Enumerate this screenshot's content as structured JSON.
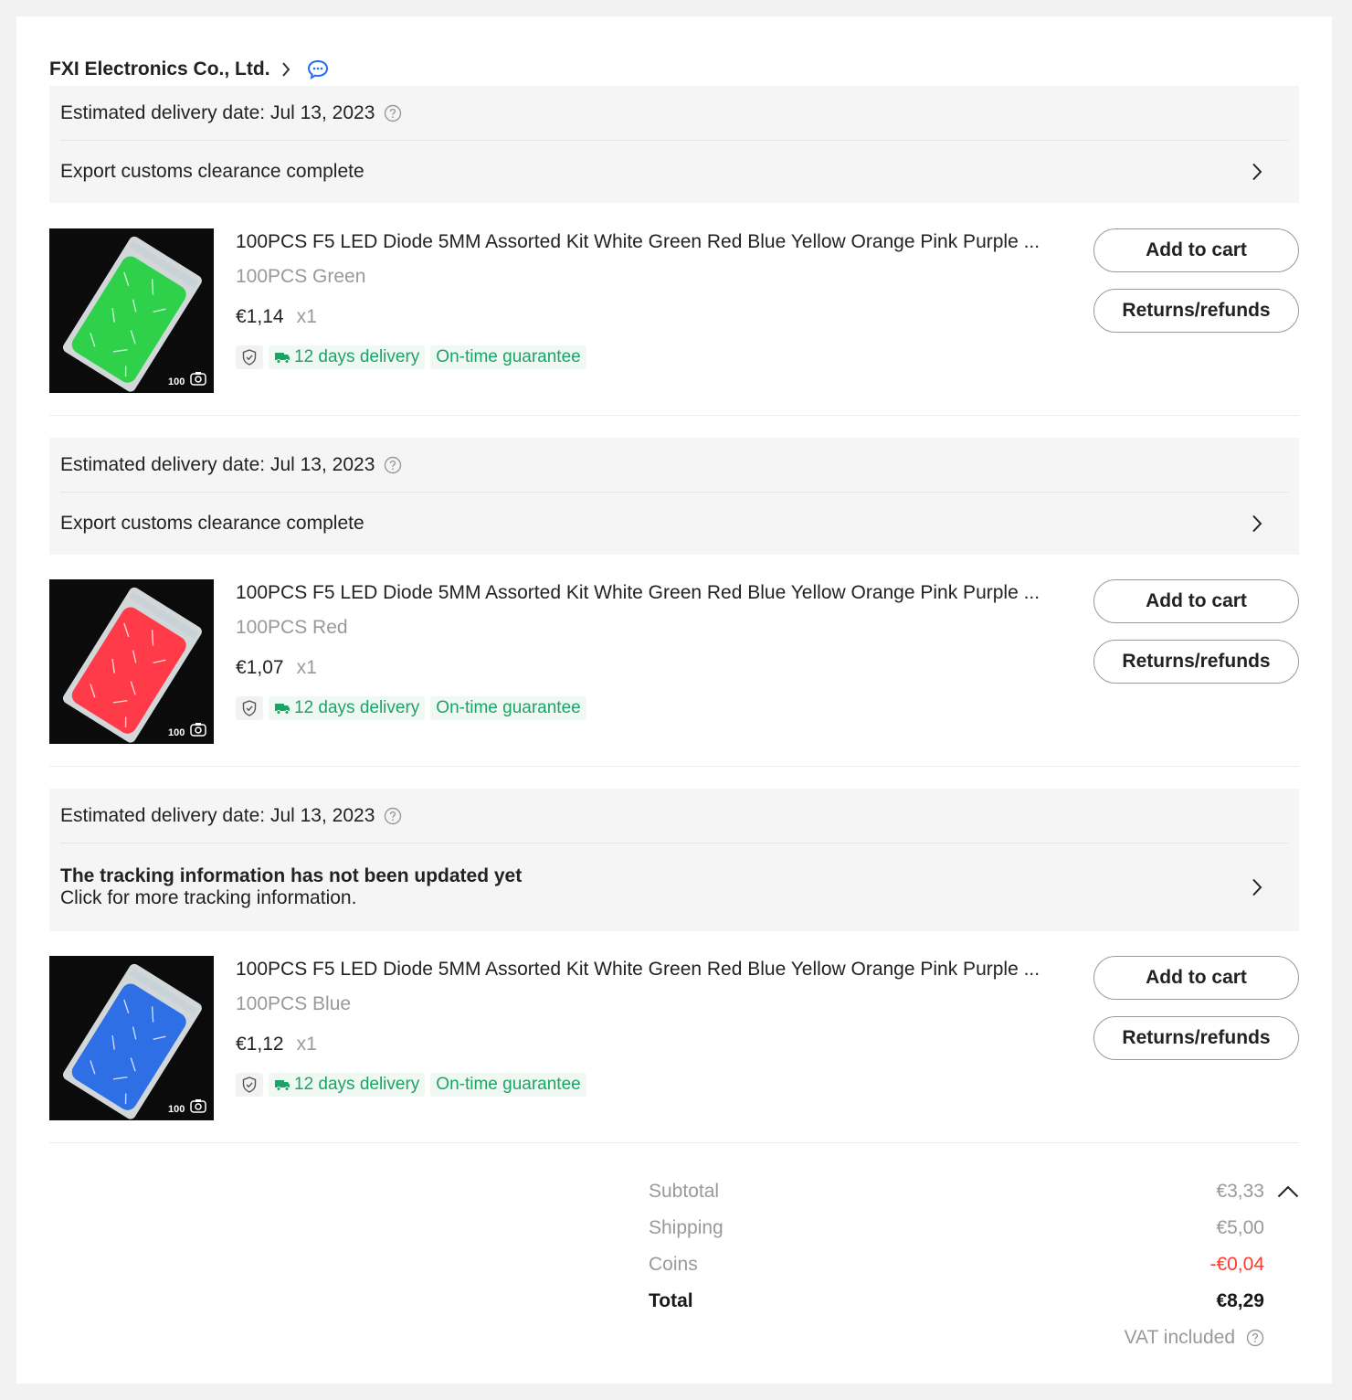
{
  "store": {
    "name": "FXI Electronics Co., Ltd."
  },
  "groups": [
    {
      "est_date": "Estimated delivery date: Jul 13, 2023",
      "status_title": "Export customs clearance complete",
      "status_sub": "",
      "item": {
        "title": "100PCS F5 LED Diode 5MM Assorted Kit White Green Red Blue Yellow Orange Pink Purple ...",
        "variant": "100PCS Green",
        "price": "€1,14",
        "qty": "x1",
        "delivery": "12 days delivery",
        "guarantee": "On-time guarantee",
        "thumb_count": "100",
        "bag_color": "#2fd14a",
        "add_to_cart": "Add to cart",
        "returns": "Returns/refunds"
      }
    },
    {
      "est_date": "Estimated delivery date: Jul 13, 2023",
      "status_title": "Export customs clearance complete",
      "status_sub": "",
      "item": {
        "title": "100PCS F5 LED Diode 5MM Assorted Kit White Green Red Blue Yellow Orange Pink Purple ...",
        "variant": "100PCS Red",
        "price": "€1,07",
        "qty": "x1",
        "delivery": "12 days delivery",
        "guarantee": "On-time guarantee",
        "thumb_count": "100",
        "bag_color": "#ff3b4a",
        "add_to_cart": "Add to cart",
        "returns": "Returns/refunds"
      }
    },
    {
      "est_date": "Estimated delivery date: Jul 13, 2023",
      "status_title": "The tracking information has not been updated yet",
      "status_sub": "Click for more tracking information.",
      "item": {
        "title": "100PCS F5 LED Diode 5MM Assorted Kit White Green Red Blue Yellow Orange Pink Purple ...",
        "variant": "100PCS Blue",
        "price": "€1,12",
        "qty": "x1",
        "delivery": "12 days delivery",
        "guarantee": "On-time guarantee",
        "thumb_count": "100",
        "bag_color": "#2e6fe6",
        "add_to_cart": "Add to cart",
        "returns": "Returns/refunds"
      }
    }
  ],
  "summary": {
    "subtotal_label": "Subtotal",
    "subtotal": "€3,33",
    "shipping_label": "Shipping",
    "shipping": "€5,00",
    "coins_label": "Coins",
    "coins": "-€0,04",
    "total_label": "Total",
    "total": "€8,29",
    "vat": "VAT included"
  },
  "colors": {
    "green": "#1ea366",
    "link_blue": "#1f6ff0",
    "negative": "#ff3b30"
  }
}
